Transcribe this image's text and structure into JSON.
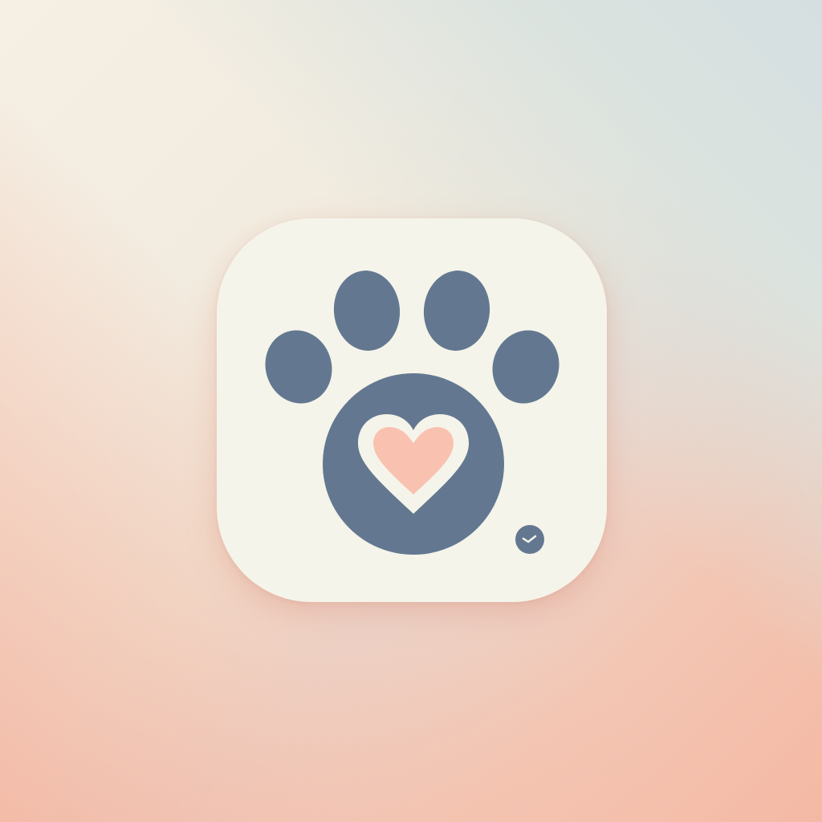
{
  "icon": {
    "name": "paw-heart-app-icon",
    "colors": {
      "tile": "#f5f4ea",
      "paw": "#637890",
      "heart": "#f9c2b0",
      "heart_outline": "#f5f4ea",
      "background_warm": "#f4b9a4",
      "background_cool": "#d5dfe0"
    }
  }
}
